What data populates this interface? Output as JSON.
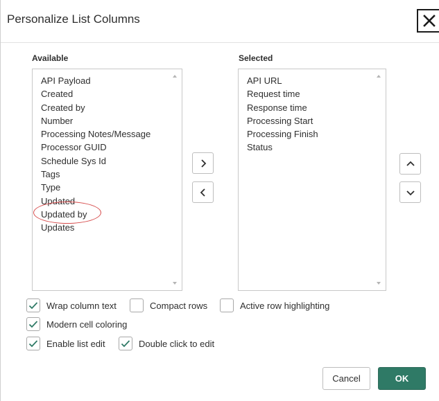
{
  "dialog": {
    "title": "Personalize List Columns",
    "close_icon": "close-icon"
  },
  "available": {
    "label": "Available",
    "items": [
      "API Payload",
      "Created",
      "Created by",
      "Number",
      "Processing Notes/Message",
      "Processor GUID",
      "Schedule Sys Id",
      "Tags",
      "Type",
      "Updated",
      "Updated by",
      "Updates"
    ],
    "highlighted_item": "Updated by"
  },
  "selected": {
    "label": "Selected",
    "items": [
      "API URL",
      "Request time",
      "Response time",
      "Processing Start",
      "Processing Finish",
      "Status"
    ]
  },
  "transfer": {
    "add_icon": "chevron-right-icon",
    "remove_icon": "chevron-left-icon"
  },
  "reorder": {
    "up_icon": "chevron-up-icon",
    "down_icon": "chevron-down-icon"
  },
  "options": {
    "wrap_column_text": {
      "label": "Wrap column text",
      "checked": true
    },
    "compact_rows": {
      "label": "Compact rows",
      "checked": false
    },
    "active_row_highlighting": {
      "label": "Active row highlighting",
      "checked": false
    },
    "modern_cell_coloring": {
      "label": "Modern cell coloring",
      "checked": true
    },
    "enable_list_edit": {
      "label": "Enable list edit",
      "checked": true
    },
    "double_click_to_edit": {
      "label": "Double click to edit",
      "checked": true
    }
  },
  "footer": {
    "cancel_label": "Cancel",
    "ok_label": "OK"
  },
  "colors": {
    "primary": "#2f7a66",
    "check": "#2f7a66",
    "highlight_ring": "#d64a4a"
  }
}
